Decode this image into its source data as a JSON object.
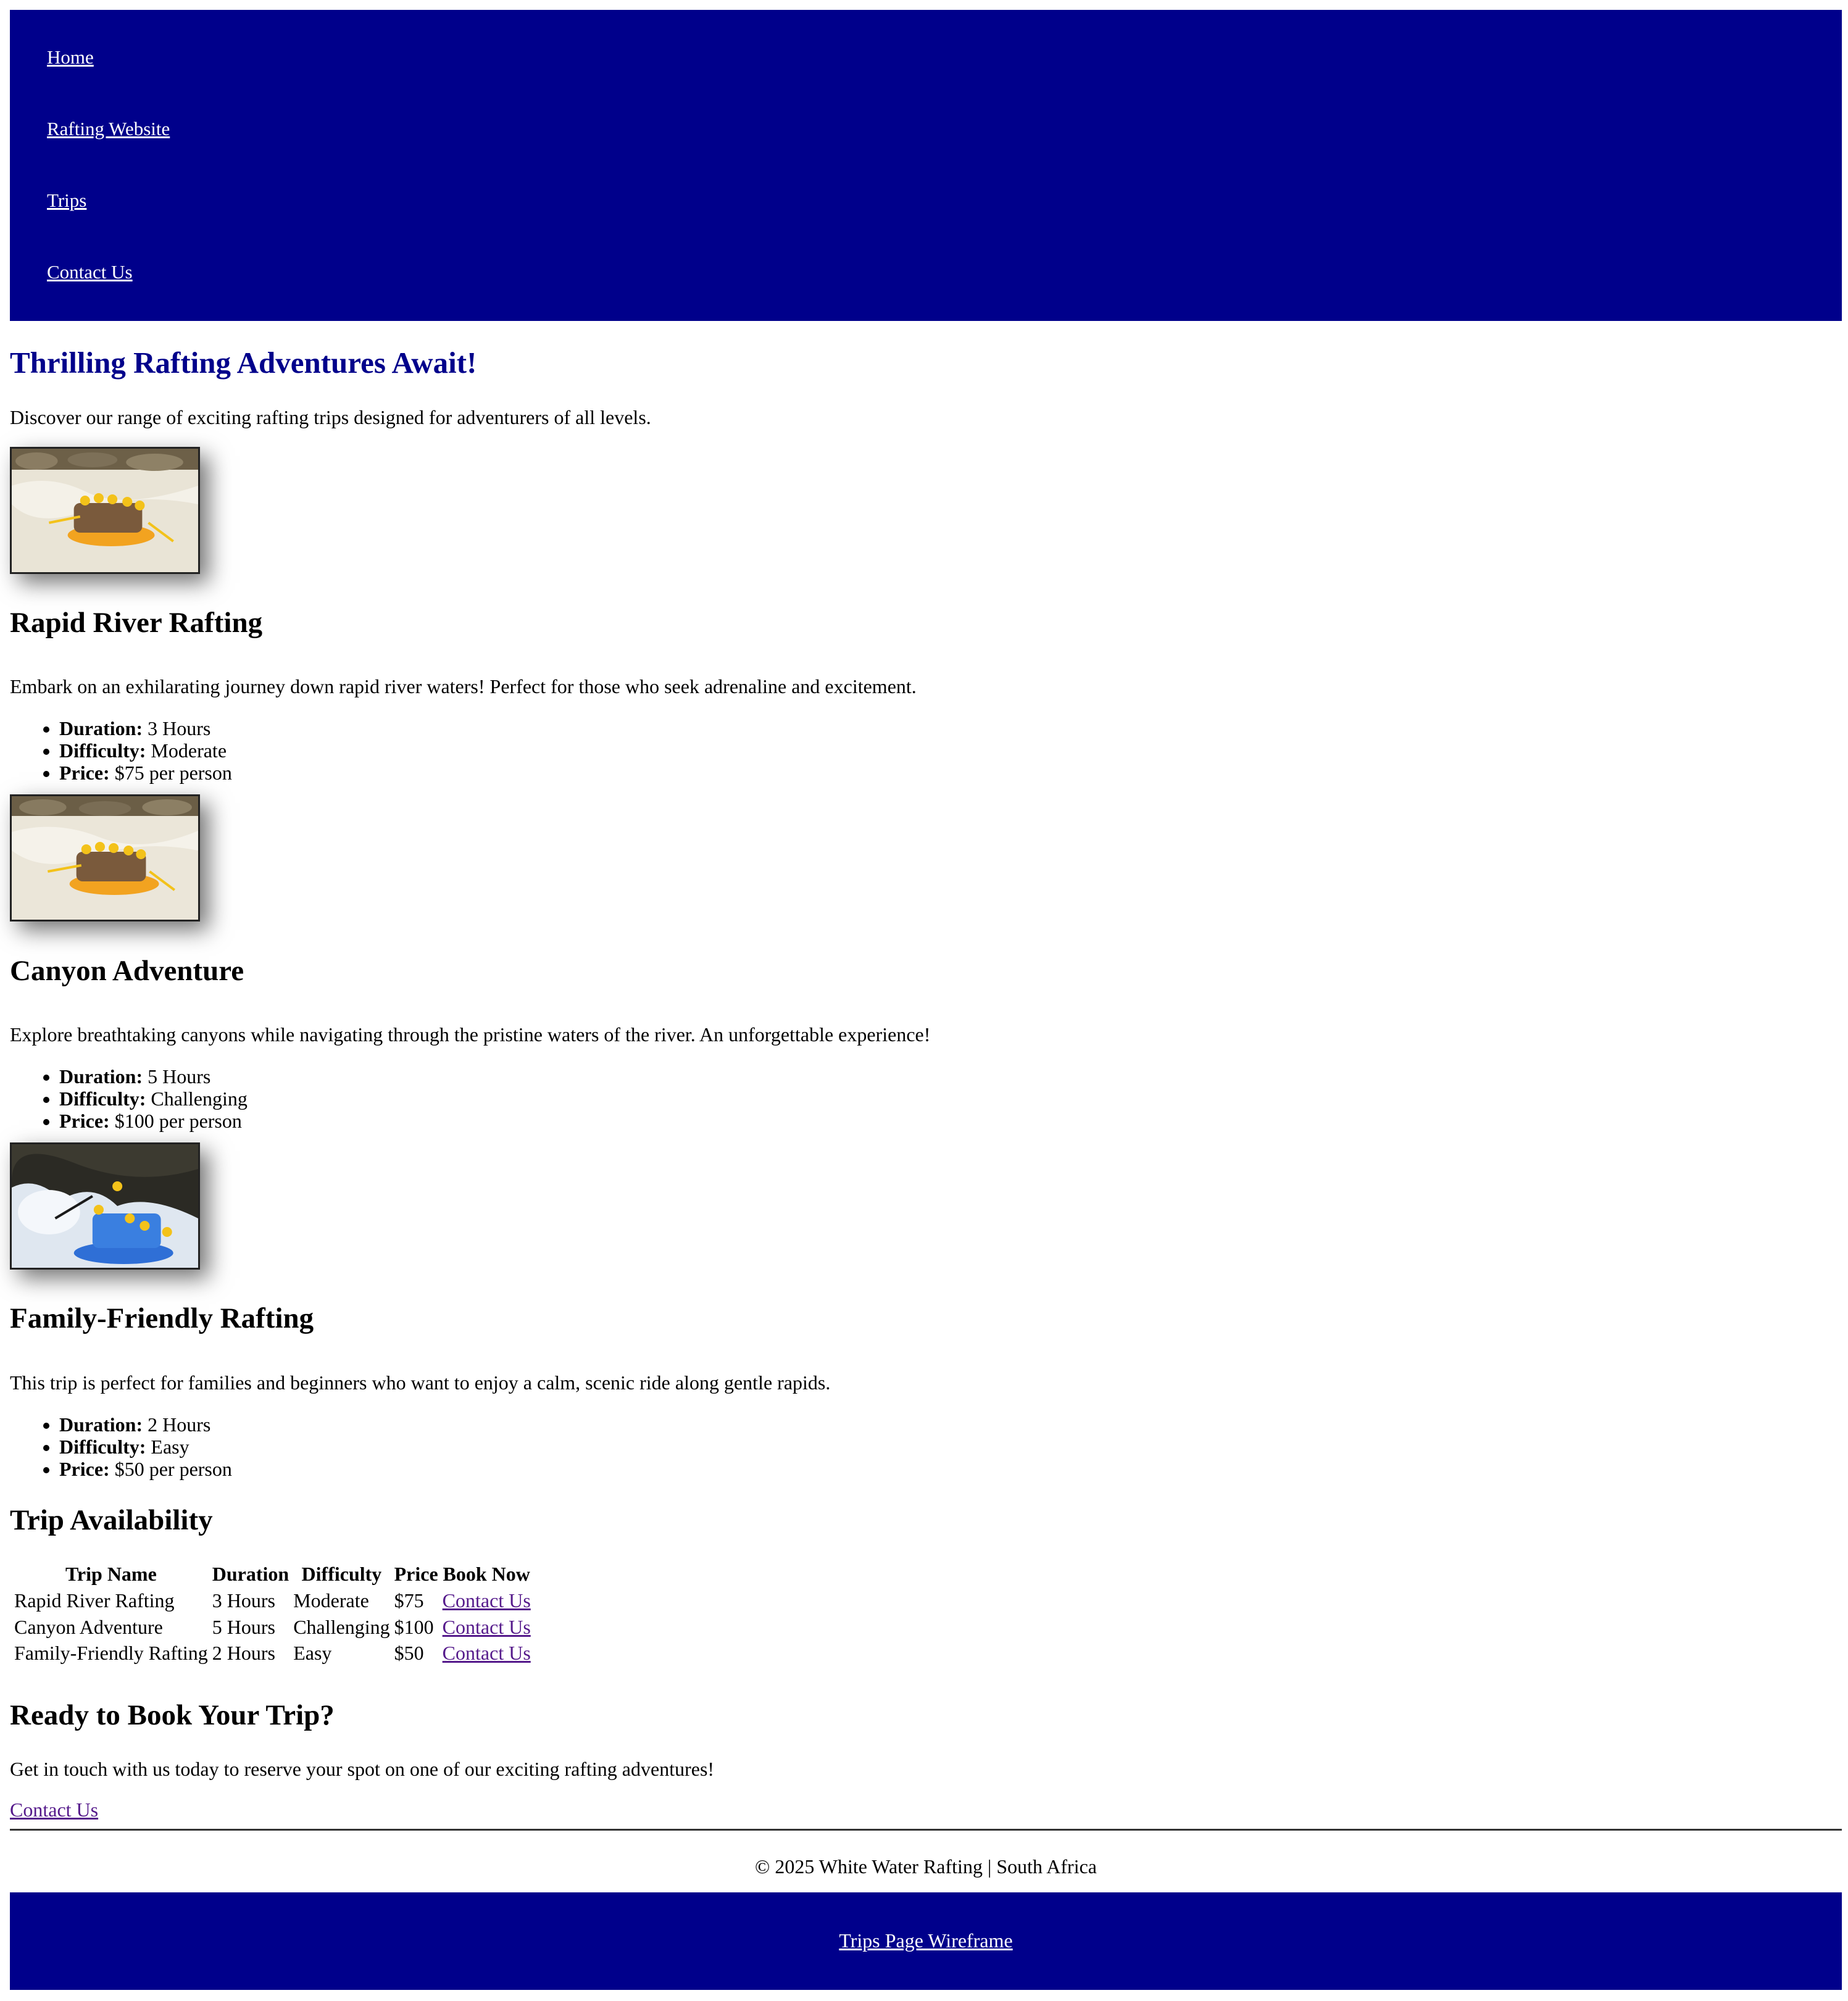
{
  "nav": {
    "items": [
      "Home",
      "Rafting Website",
      "Trips",
      "Contact Us"
    ]
  },
  "main": {
    "title": "Thrilling Rafting Adventures Await!",
    "intro": "Discover our range of exciting rafting trips designed for adventurers of all levels."
  },
  "trips": [
    {
      "name": "Rapid River Rafting",
      "description": "Embark on an exhilarating journey down rapid river waters! Perfect for those who seek adrenaline and excitement.",
      "duration_label": "Duration:",
      "duration": "3 Hours",
      "difficulty_label": "Difficulty:",
      "difficulty": "Moderate",
      "price_label": "Price:",
      "price": "$75 per person",
      "image": "rafting-photo-yellow-raft"
    },
    {
      "name": "Canyon Adventure",
      "description": "Explore breathtaking canyons while navigating through the pristine waters of the river. An unforgettable experience!",
      "duration_label": "Duration:",
      "duration": "5 Hours",
      "difficulty_label": "Difficulty:",
      "difficulty": "Challenging",
      "price_label": "Price:",
      "price": "$100 per person",
      "image": "rafting-photo-yellow-raft"
    },
    {
      "name": "Family-Friendly Rafting",
      "description": "This trip is perfect for families and beginners who want to enjoy a calm, scenic ride along gentle rapids.",
      "duration_label": "Duration:",
      "duration": "2 Hours",
      "difficulty_label": "Difficulty:",
      "difficulty": "Easy",
      "price_label": "Price:",
      "price": "$50 per person",
      "image": "rafting-photo-blue-raft"
    }
  ],
  "availability": {
    "title": "Trip Availability",
    "headers": [
      "Trip Name",
      "Duration",
      "Difficulty",
      "Price",
      "Book Now"
    ],
    "rows": [
      [
        "Rapid River Rafting",
        "3 Hours",
        "Moderate",
        "$75",
        "Contact Us"
      ],
      [
        "Canyon Adventure",
        "5 Hours",
        "Challenging",
        "$100",
        "Contact Us"
      ],
      [
        "Family-Friendly Rafting",
        "2 Hours",
        "Easy",
        "$50",
        "Contact Us"
      ]
    ]
  },
  "booking": {
    "title": "Ready to Book Your Trip?",
    "text": "Get in touch with us today to reserve your spot on one of our exciting rafting adventures!",
    "link": "Contact Us"
  },
  "footer": {
    "copyright": "© 2025 White Water Rafting | South Africa",
    "link": "Trips Page Wireframe"
  },
  "colors": {
    "nav_bg": "#00008b",
    "heading_accent": "#00008b",
    "visited_link": "#551a8b"
  }
}
